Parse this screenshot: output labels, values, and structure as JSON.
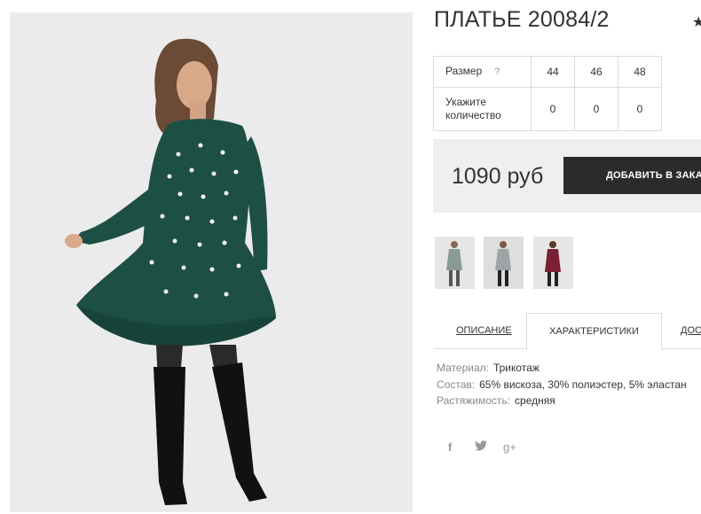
{
  "product": {
    "title": "ПЛАТЬЕ 20084/2",
    "favorite_icon": "star-icon"
  },
  "size_table": {
    "size_label": "Размер",
    "help_mark": "?",
    "sizes": [
      "44",
      "46",
      "48"
    ],
    "qty_label": "Укажите количество",
    "quantities": [
      "0",
      "0",
      "0"
    ]
  },
  "purchase": {
    "price": "1090 руб",
    "add_button_label": "ДОБАВИТЬ В ЗАКАЗ",
    "button_icon": "shopping-bag-icon"
  },
  "thumbnails": [
    {
      "color": "#8a9a97"
    },
    {
      "color": "#9ea4a6"
    },
    {
      "color": "#7b1f33"
    }
  ],
  "tabs": {
    "description": "ОПИСАНИЕ",
    "characteristics": "ХАРАКТЕРИСТИКИ",
    "delivery": "ДОСТАВКА"
  },
  "specs": [
    {
      "key": "Материал:",
      "value": "Трикотаж"
    },
    {
      "key": "Состав:",
      "value": "65% вискоза, 30% полиэстер, 5% эластан"
    },
    {
      "key": "Растяжимость:",
      "value": "средняя"
    }
  ],
  "social": {
    "facebook": "f",
    "twitter": "twitter-bird-icon",
    "googleplus": "g+"
  },
  "colors": {
    "dress": "#1d4f45",
    "button": "#2b2b2b",
    "price_bg": "#efefef"
  }
}
